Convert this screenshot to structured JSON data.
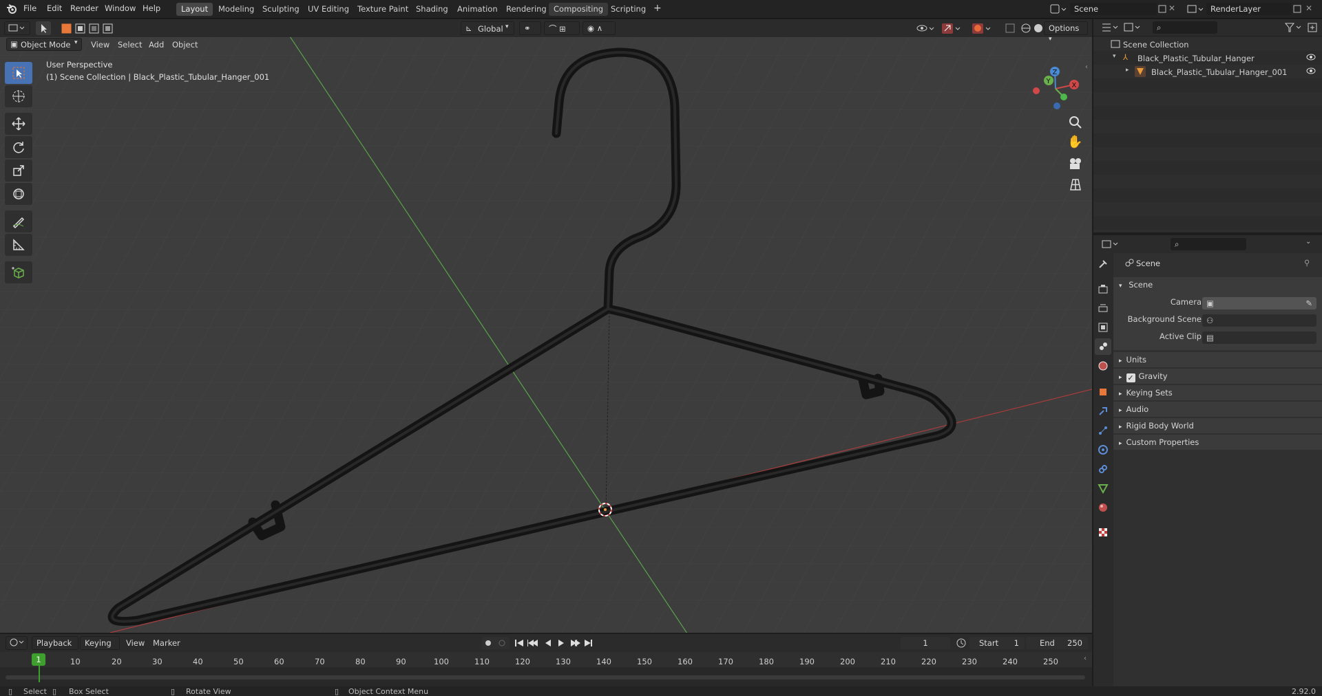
{
  "app": {
    "menus": [
      "File",
      "Edit",
      "Render",
      "Window",
      "Help"
    ],
    "workspace_tabs": [
      "Layout",
      "Modeling",
      "Sculpting",
      "UV Editing",
      "Texture Paint",
      "Shading",
      "Animation",
      "Rendering",
      "Compositing",
      "Scripting"
    ],
    "active_tab": "Layout",
    "add_tab": "+",
    "scene_field": "Scene",
    "layer_field": "RenderLayer"
  },
  "viewport_header": {
    "mode": "Object Mode",
    "menus": [
      "View",
      "Select",
      "Add",
      "Object"
    ],
    "transform_orientation": "Global",
    "options": "Options"
  },
  "viewport": {
    "perspective_label": "User Perspective",
    "collection_label": "(1) Scene Collection | Black_Plastic_Tubular_Hanger_001",
    "gizmo": {
      "x": "X",
      "y": "Y",
      "z": "Z"
    }
  },
  "outliner": {
    "root": "Scene Collection",
    "items": [
      {
        "label": "Black_Plastic_Tubular_Hanger"
      },
      {
        "label": "Black_Plastic_Tubular_Hanger_001"
      }
    ]
  },
  "properties": {
    "context_title": "Scene",
    "section": "Scene",
    "fields": [
      {
        "label": "Camera",
        "value": ""
      },
      {
        "label": "Background Scene",
        "value": ""
      },
      {
        "label": "Active Clip",
        "value": ""
      }
    ],
    "subpanels": [
      {
        "label": "Units",
        "checkbox": false
      },
      {
        "label": "Gravity",
        "checkbox": true
      },
      {
        "label": "Keying Sets",
        "checkbox": false
      },
      {
        "label": "Audio",
        "checkbox": false
      },
      {
        "label": "Rigid Body World",
        "checkbox": false
      },
      {
        "label": "Custom Properties",
        "checkbox": false
      }
    ]
  },
  "timeline": {
    "menus": [
      "Playback",
      "Keying",
      "View",
      "Marker"
    ],
    "current_frame": "1",
    "start_label": "Start",
    "start": "1",
    "end_label": "End",
    "end": "250",
    "ticks": [
      "1",
      "10",
      "20",
      "30",
      "40",
      "50",
      "60",
      "70",
      "80",
      "90",
      "100",
      "110",
      "120",
      "130",
      "140",
      "150",
      "160",
      "170",
      "180",
      "190",
      "200",
      "210",
      "220",
      "230",
      "240",
      "250"
    ]
  },
  "statusbar": {
    "items": [
      "Select",
      "Box Select",
      "Rotate View",
      "Object Context Menu"
    ],
    "version": "2.92.0"
  },
  "colors": {
    "accent": "#4772b3",
    "active_frame": "#3e9e2e",
    "selection": "#e8773a"
  }
}
